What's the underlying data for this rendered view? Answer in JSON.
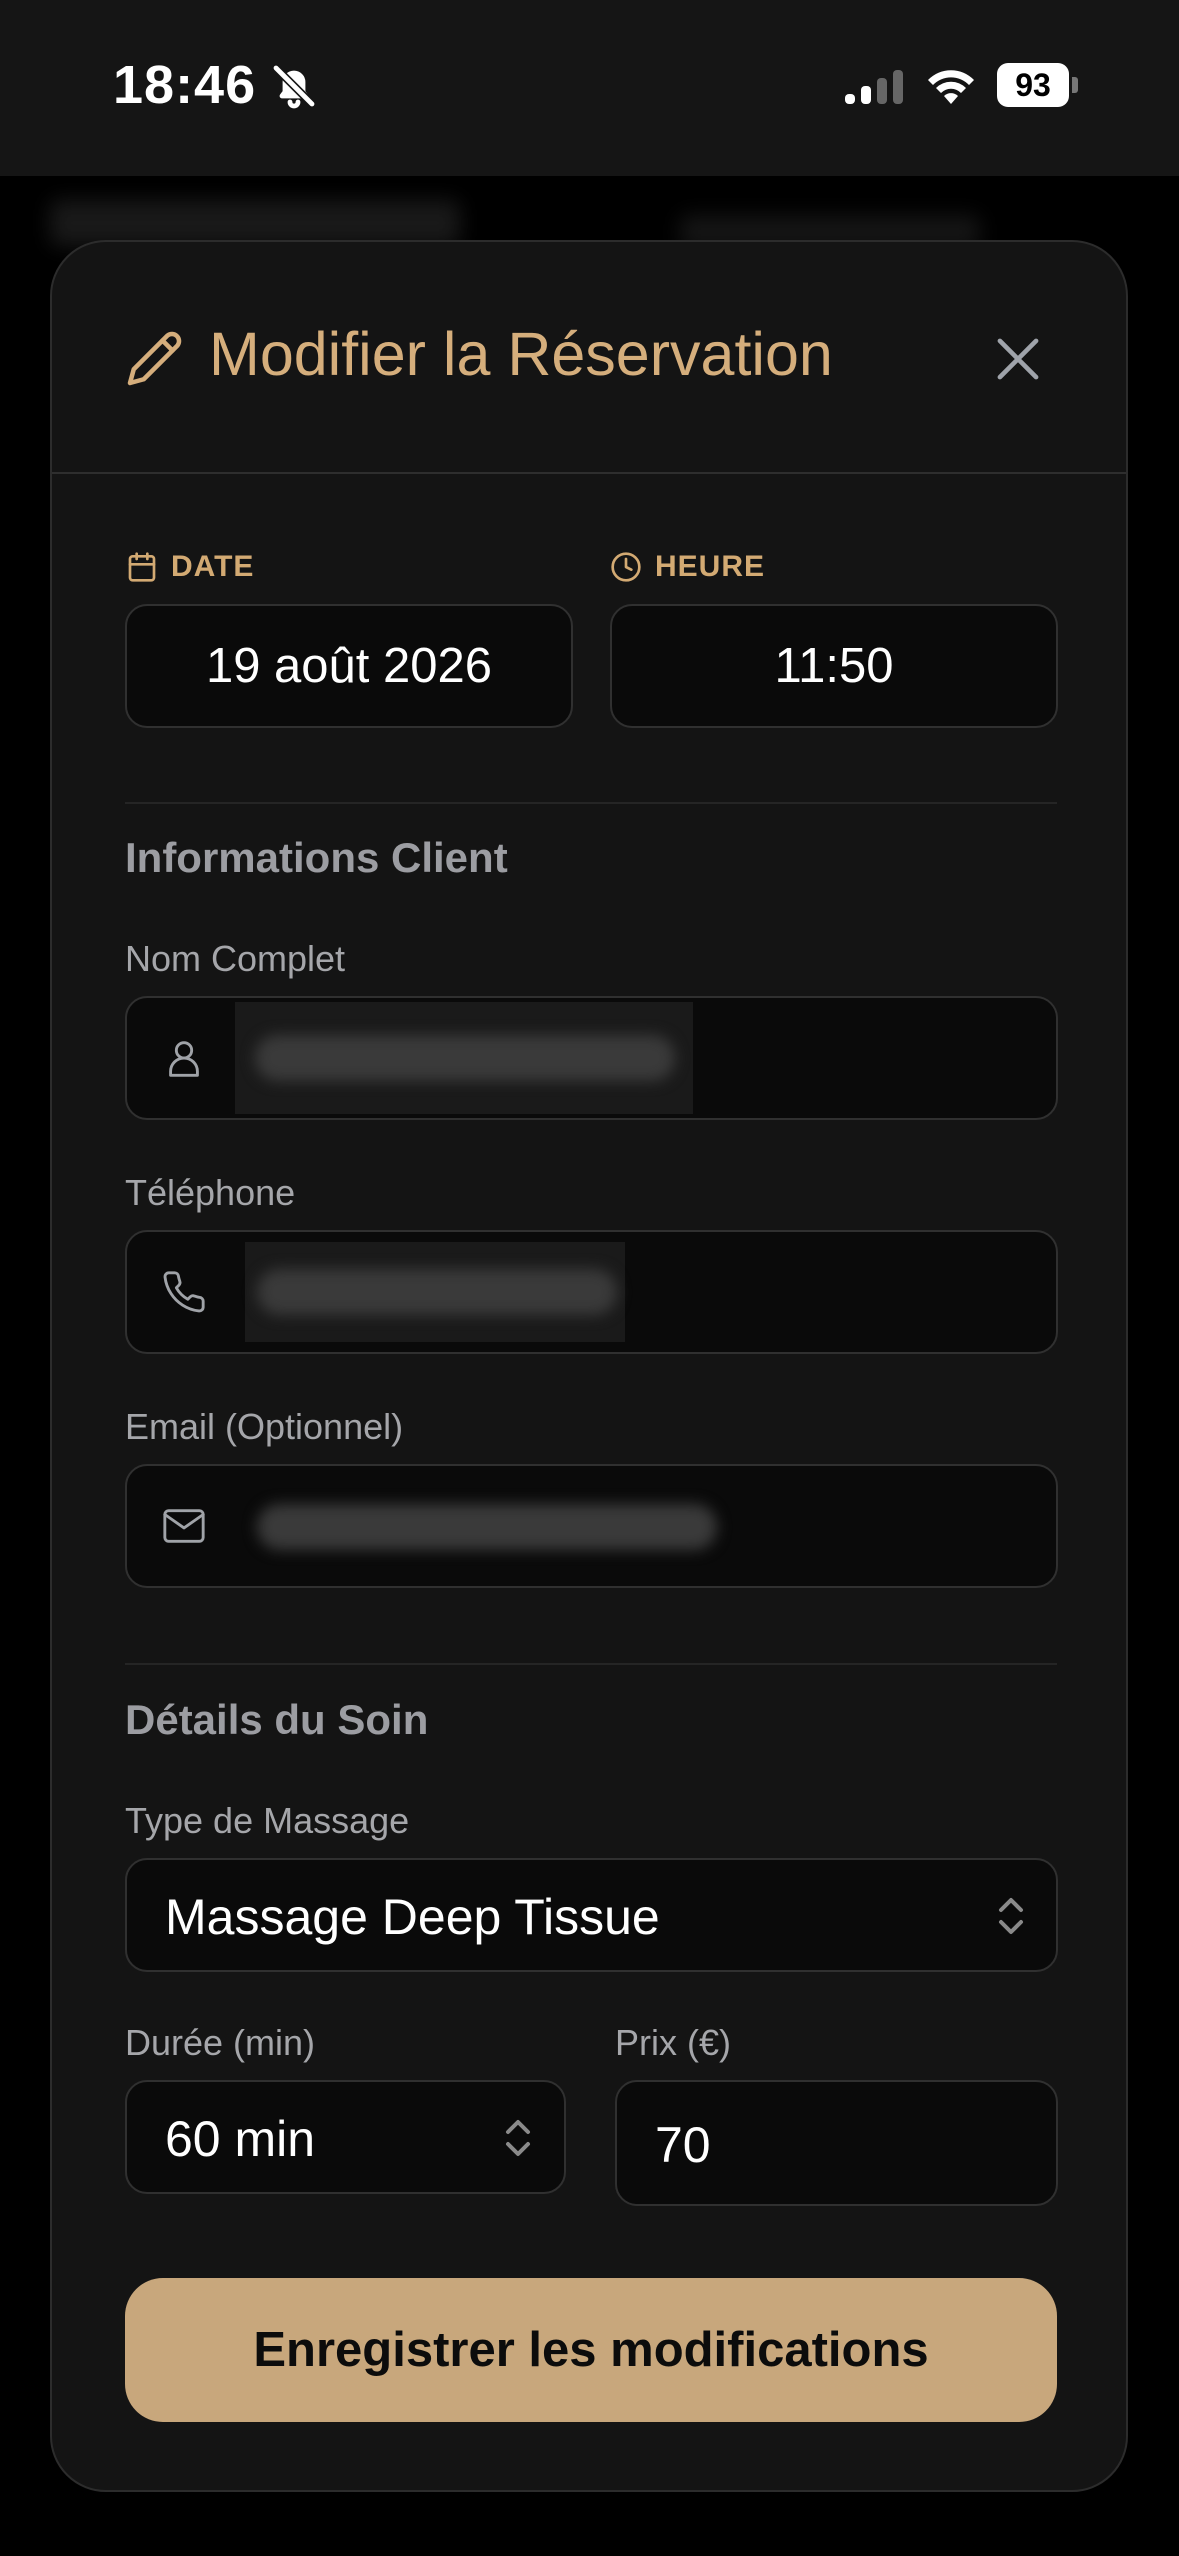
{
  "status_bar": {
    "time": "18:46",
    "battery": "93",
    "icons": [
      "bell-slash-icon",
      "cellular-signal-icon",
      "wifi-icon",
      "battery-icon"
    ]
  },
  "modal": {
    "title": "Modifier la Réservation",
    "title_icon": "pencil-icon",
    "close_icon": "close-icon",
    "date": {
      "label": "DATE",
      "icon": "calendar-icon",
      "value": "19 août 2026"
    },
    "time": {
      "label": "HEURE",
      "icon": "clock-icon",
      "value": "11:50"
    },
    "client_section": {
      "title": "Informations Client",
      "name": {
        "label": "Nom Complet",
        "icon": "user-icon"
      },
      "phone": {
        "label": "Téléphone",
        "icon": "phone-icon"
      },
      "email": {
        "label": "Email (Optionnel)",
        "icon": "mail-icon"
      }
    },
    "care_section": {
      "title": "Détails du Soin",
      "massage_type": {
        "label": "Type de Massage",
        "value": "Massage Deep Tissue"
      },
      "duration": {
        "label": "Durée (min)",
        "value": "60 min"
      },
      "price": {
        "label": "Prix (€)",
        "value": "70"
      }
    },
    "save_label": "Enregistrer les modifications"
  },
  "colors": {
    "accent_gold": "#d5ae7c",
    "button_gold": "#c8a77c",
    "modal_bg": "#141414",
    "input_bg": "#0a0a0a"
  }
}
